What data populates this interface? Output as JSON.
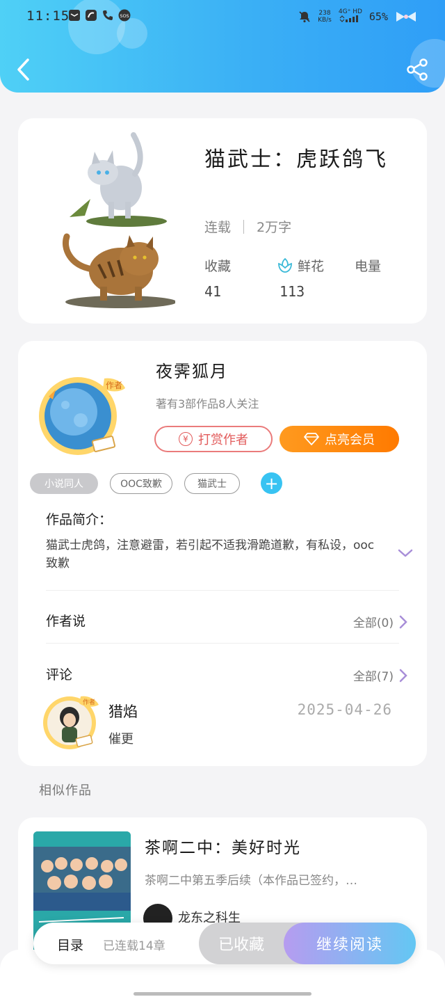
{
  "status_bar": {
    "time": "11:15",
    "net_speed_value": "238",
    "net_speed_unit": "KB/s",
    "net_type": "4G⁺ HD",
    "battery": "65%"
  },
  "book": {
    "title": "猫武士：虎跃鸽飞",
    "status": "连载",
    "word_count": "2万字",
    "stats": {
      "favorites_label": "收藏",
      "favorites_value": "41",
      "flowers_label": "鲜花",
      "flowers_value": "113",
      "power_label": "电量"
    }
  },
  "author": {
    "name": "夜霁狐月",
    "works_info": "著有3部作品8人关注",
    "badge_text": "作者",
    "tip_button": "打赏作者",
    "tip_icon_char": "¥",
    "vip_button": "点亮会员"
  },
  "tags": [
    "小说同人",
    "OOC致歉",
    "猫武士"
  ],
  "intro": {
    "label": "作品简介：",
    "text": "猫武士虎鸽，注意避雷，若引起不适我滑跪道歉，有私设，ooc致歉"
  },
  "author_says": {
    "label": "作者说",
    "link": "全部(0)"
  },
  "comments": {
    "label": "评论",
    "link": "全部(7)",
    "items": [
      {
        "user": "猎焰",
        "text": "催更",
        "date": "2025-04-26",
        "badge_text": "作者"
      }
    ]
  },
  "similar": {
    "section_title": "相似作品",
    "items": [
      {
        "title": "茶啊二中：美好时光",
        "desc": "茶啊二中第五季后续（本作品已签约，…",
        "author": "龙东之科生"
      }
    ]
  },
  "bottom_bar": {
    "catalog": "目录",
    "progress": "已连载14章",
    "collected": "已收藏",
    "read": "继续阅读"
  },
  "colors": {
    "header_accent": "#3bb0f5",
    "vip_orange": "#ff8a10",
    "tip_red": "#e25b5b",
    "tag_add_blue": "#38c3f2",
    "read_gradient_start": "#b69cf0",
    "read_gradient_end": "#63c7f3"
  }
}
